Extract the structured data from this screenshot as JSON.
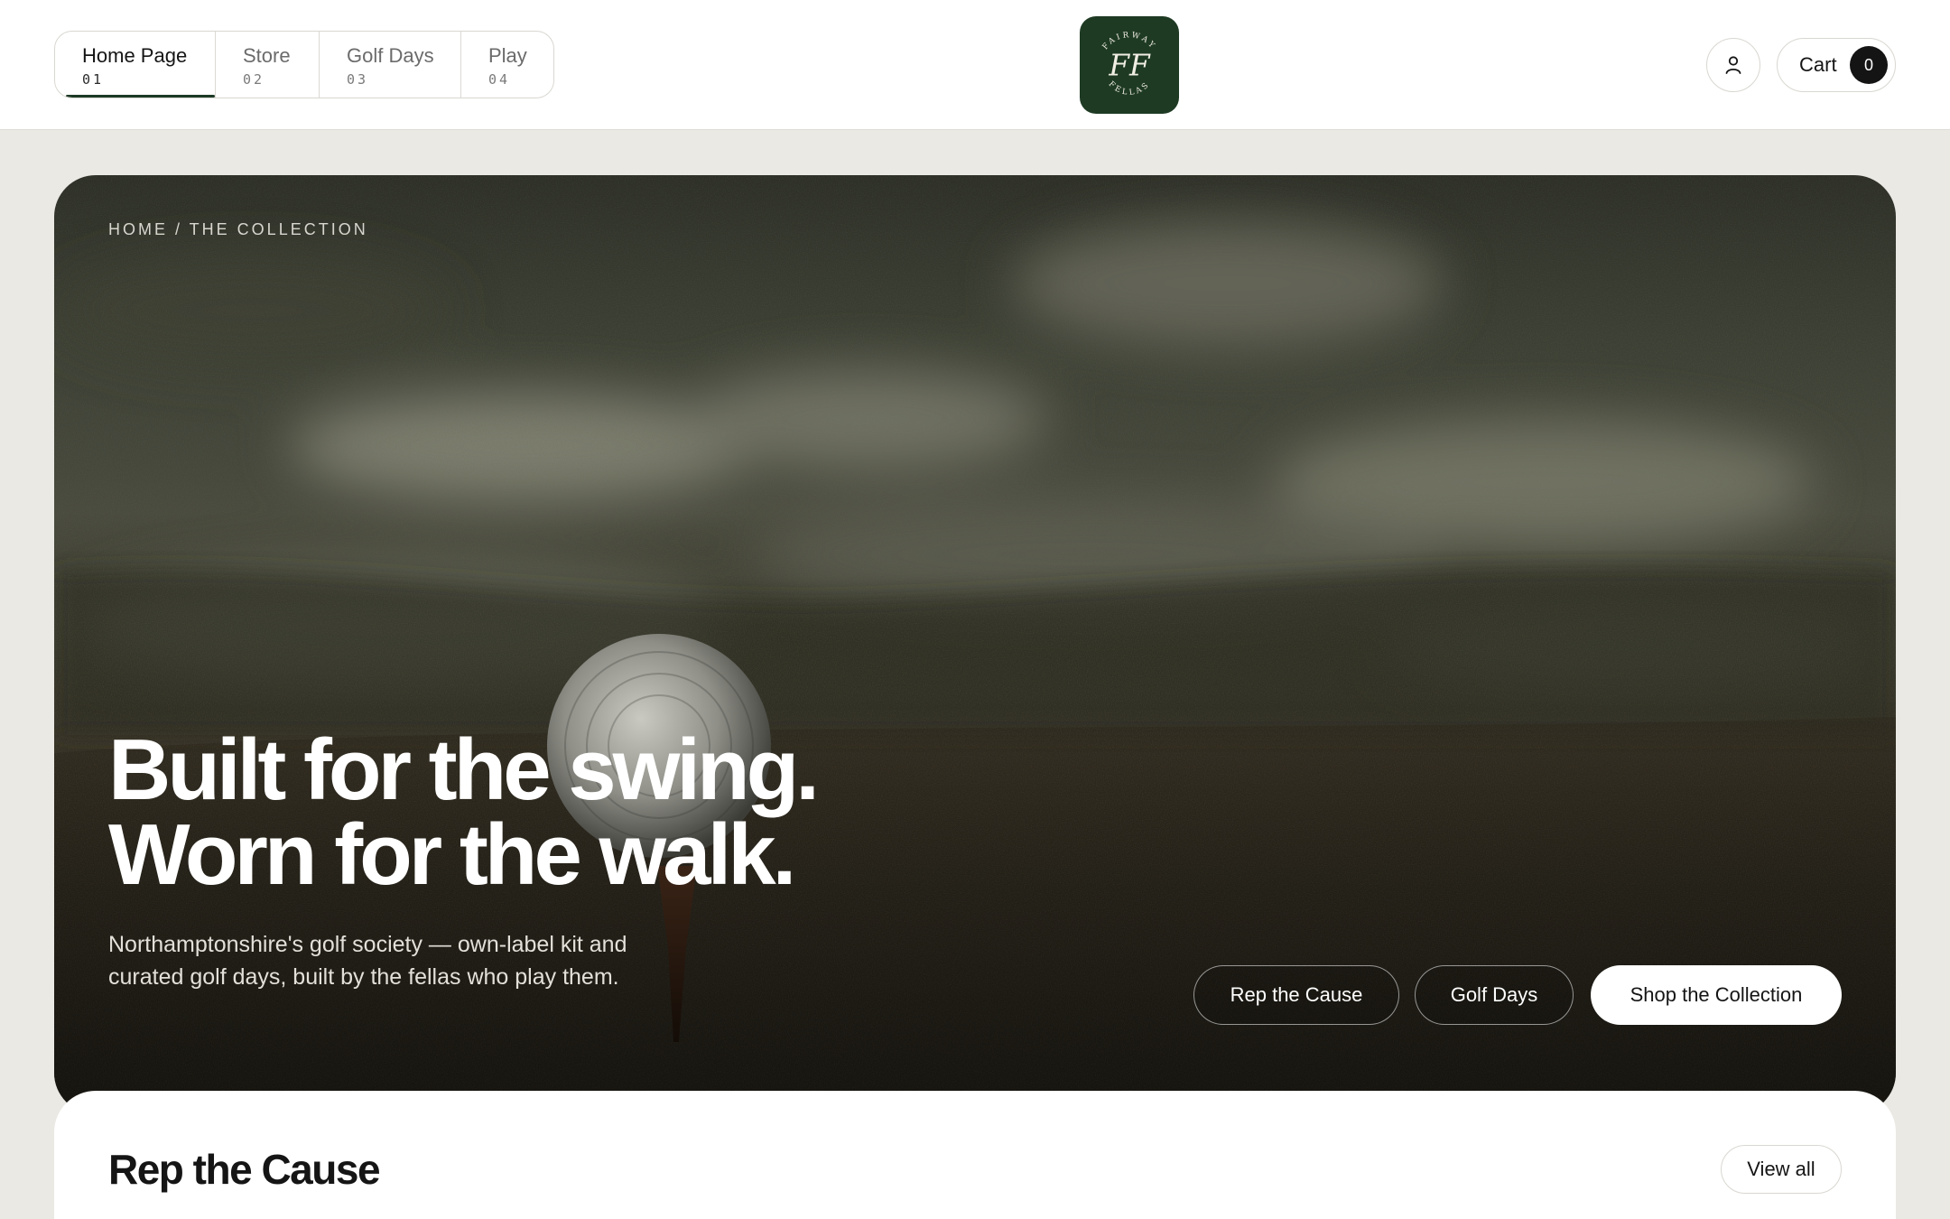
{
  "header": {
    "nav": [
      {
        "label": "Home Page",
        "num": "01"
      },
      {
        "label": "Store",
        "num": "02"
      },
      {
        "label": "Golf Days",
        "num": "03"
      },
      {
        "label": "Play",
        "num": "04"
      }
    ],
    "logo": {
      "top_text": "FAIRWAY",
      "monogram": "FF",
      "bottom_text": "FELLAS",
      "color": "#1e3a23"
    },
    "account_icon": "user-icon",
    "cart": {
      "label": "Cart",
      "count": "0"
    }
  },
  "hero": {
    "breadcrumb": "HOME / THE COLLECTION",
    "headline_line1": "Built for the swing.",
    "headline_line2": "Worn for the walk.",
    "subcopy": "Northamptonshire's golf society — own-label kit and curated golf days, built by the fellas who play them.",
    "buttons": {
      "rep": "Rep the Cause",
      "days": "Golf Days",
      "shop": "Shop the Collection"
    }
  },
  "section": {
    "title": "Rep the Cause",
    "view_all": "View all"
  },
  "colors": {
    "accent": "#1e3a23",
    "page_bg": "#ebe9e4"
  }
}
